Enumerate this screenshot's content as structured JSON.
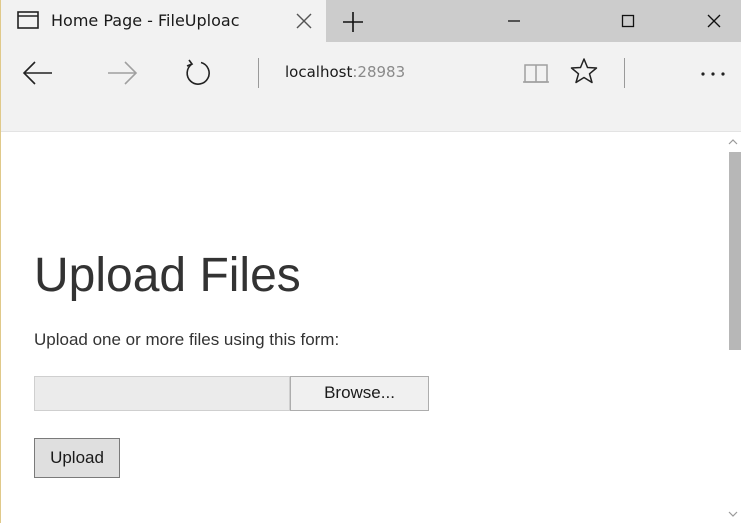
{
  "tab": {
    "title": "Home Page - FileUploac",
    "icon": "page-icon",
    "close_icon": "close-icon"
  },
  "new_tab_icon": "plus-icon",
  "window_controls": {
    "minimize_icon": "minimize-icon",
    "maximize_icon": "maximize-icon",
    "close_icon": "close-icon"
  },
  "toolbar": {
    "back_icon": "back-arrow-icon",
    "forward_icon": "forward-arrow-icon",
    "refresh_icon": "refresh-icon",
    "reading_view_icon": "reading-view-icon",
    "favorite_icon": "star-icon",
    "more_label": "···"
  },
  "address": {
    "host": "localhost",
    "port": ":28983"
  },
  "page": {
    "title": "Upload Files",
    "subtitle": "Upload one or more files using this form:",
    "file_input_value": "",
    "browse_label": "Browse...",
    "upload_label": "Upload"
  },
  "colors": {
    "tabstrip_bg": "#cccccc",
    "toolbar_bg": "#f2f2f2",
    "text": "#333333",
    "scroll_thumb": "#b7b7b7"
  }
}
